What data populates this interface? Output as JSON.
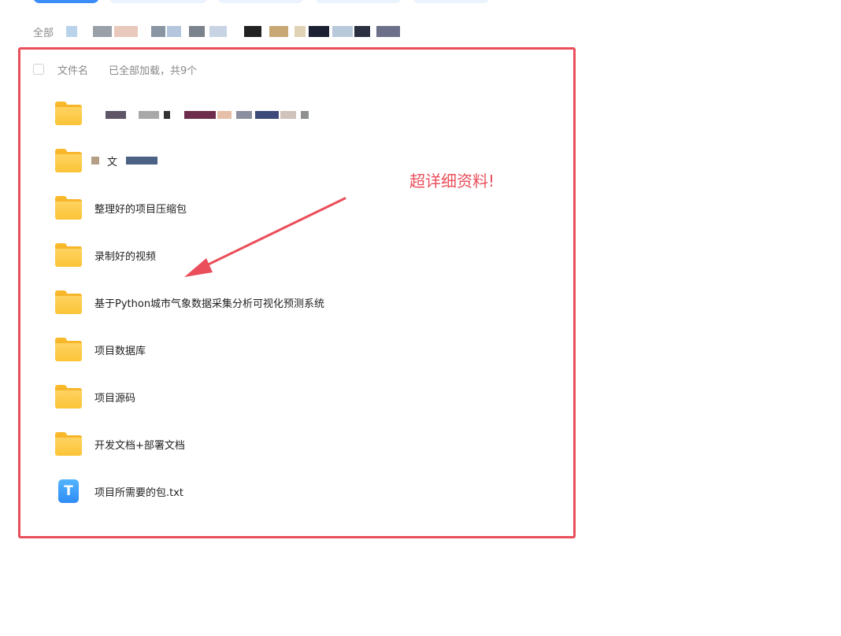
{
  "breadcrumb": {
    "root_label": "全部"
  },
  "file_list": {
    "select_all_label": "",
    "column_name": "文件名",
    "status": "已全部加载，共9个",
    "items": [
      {
        "type": "folder",
        "name": ""
      },
      {
        "type": "folder",
        "name": "文"
      },
      {
        "type": "folder",
        "name": "整理好的项目压缩包"
      },
      {
        "type": "folder",
        "name": "录制好的视频"
      },
      {
        "type": "folder",
        "name": "基于Python城市气象数据采集分析可视化预测系统"
      },
      {
        "type": "folder",
        "name": "项目数据库"
      },
      {
        "type": "folder",
        "name": "项目源码"
      },
      {
        "type": "folder",
        "name": "开发文档+部署文档"
      },
      {
        "type": "txt",
        "name": "项目所需要的包.txt",
        "icon_glyph": "T"
      }
    ]
  },
  "annotation": {
    "text": "超详细资料!",
    "color": "#ea4e5a"
  },
  "colors": {
    "folder": "#fbc437",
    "txt_icon": "#2f8cf5",
    "frame": "#ea4e5a",
    "primary_button": "#3b8cf6"
  }
}
